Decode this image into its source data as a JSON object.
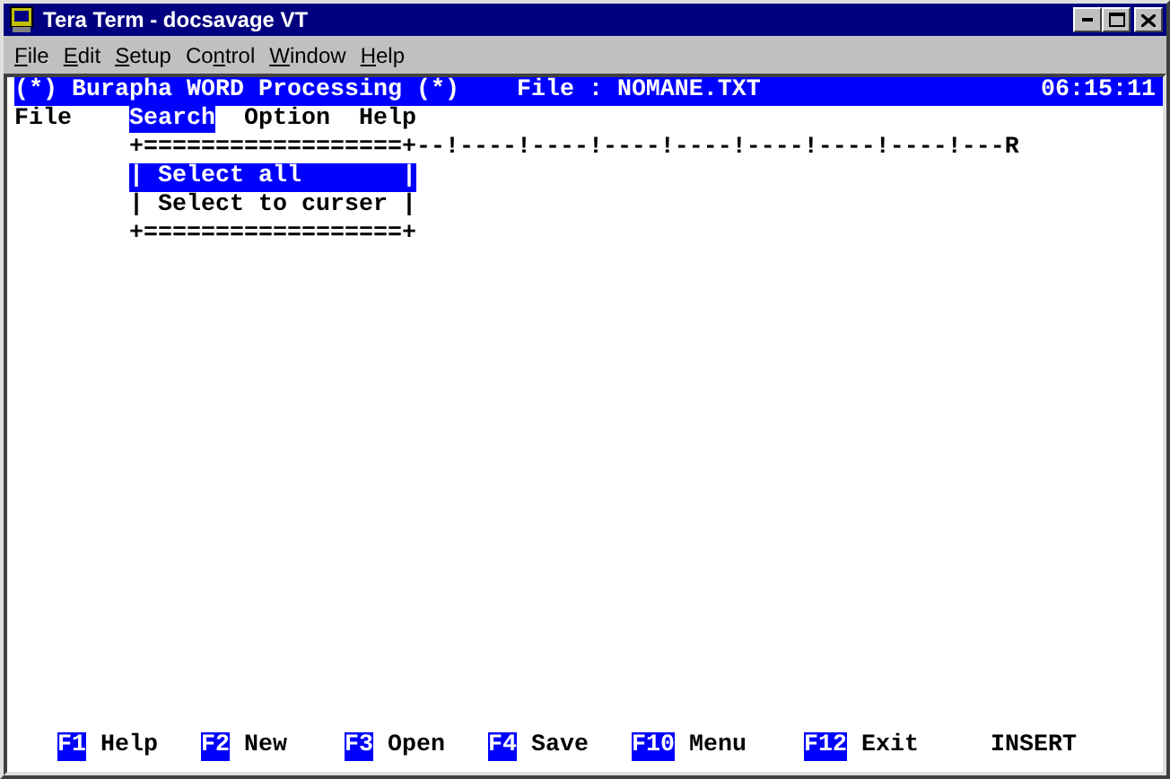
{
  "window": {
    "title": "Tera Term - docsavage VT"
  },
  "menu_bar": [
    {
      "key": "F",
      "after": "ile"
    },
    {
      "key": "E",
      "after": "dit"
    },
    {
      "key": "S",
      "after": "etup"
    },
    {
      "before": "Co",
      "key": "n",
      "after": "trol"
    },
    {
      "key": "W",
      "after": "indow"
    },
    {
      "key": "H",
      "after": "elp"
    }
  ],
  "terminal": {
    "header": {
      "title": "(*) Burapha WORD Processing (*)",
      "file": "File : NOMANE.TXT",
      "time": "06:15:11"
    },
    "menu": [
      {
        "label": "File",
        "selected": false
      },
      {
        "label": "Search",
        "selected": true
      },
      {
        "label": "Option",
        "selected": false
      },
      {
        "label": "Help",
        "selected": false
      }
    ],
    "ruler": "+==================+--!----!----!----!----!----!----!----!---R",
    "dropdown": {
      "items": [
        {
          "label": "| Select all       |",
          "selected": true
        },
        {
          "label": "| Select to curser |",
          "selected": false
        }
      ],
      "bottom_border": "+==================+"
    },
    "function_keys": [
      {
        "key": "F1",
        "label": "Help"
      },
      {
        "key": "F2",
        "label": "New"
      },
      {
        "key": "F3",
        "label": "Open"
      },
      {
        "key": "F4",
        "label": "Save"
      },
      {
        "key": "F10",
        "label": "Menu"
      },
      {
        "key": "F12",
        "label": "Exit"
      }
    ],
    "mode": "INSERT"
  }
}
